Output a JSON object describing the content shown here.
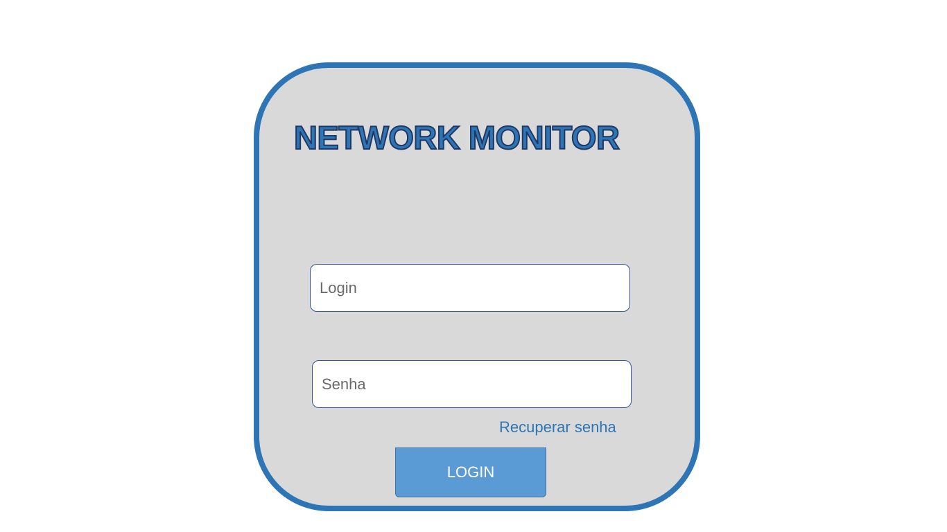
{
  "app": {
    "title": "NETWORK MONITOR"
  },
  "form": {
    "login_field": {
      "value": "",
      "placeholder": "Login"
    },
    "password_field": {
      "value": "",
      "placeholder": "Senha"
    },
    "recover_link_label": "Recuperar senha",
    "login_button_label": "LOGIN"
  },
  "colors": {
    "accent": "#2e75b6",
    "card_background": "#d9d9d9",
    "button_background": "#5b9bd5",
    "title_outline": "#1f3864"
  }
}
